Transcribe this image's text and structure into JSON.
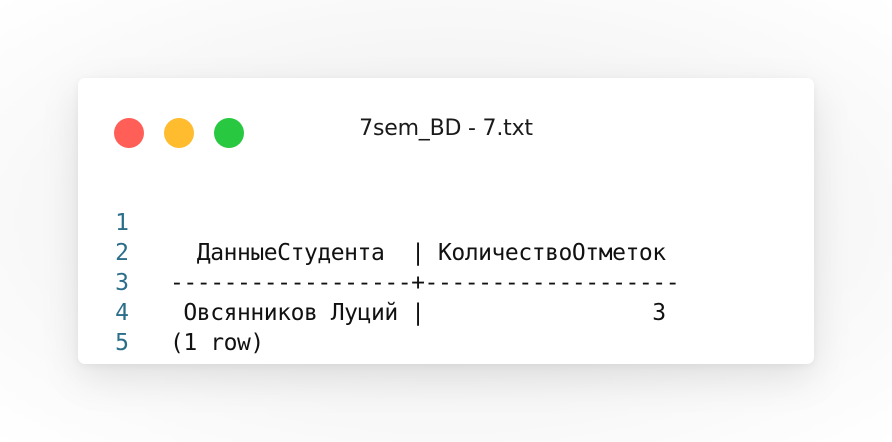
{
  "window": {
    "title": "7sem_BD - 7.txt",
    "controls": {
      "close_color": "#ff5f57",
      "minimize_color": "#febc2e",
      "maximize_color": "#28c840"
    }
  },
  "editor": {
    "lines": [
      {
        "number": "1",
        "text": "  ДанныеСтудента  | КоличествоОтметок"
      },
      {
        "number": "2",
        "text": "------------------+-------------------"
      },
      {
        "number": "3",
        "text": " Овсянников Луций |                 3"
      },
      {
        "number": "4",
        "text": "(1 row)"
      },
      {
        "number": "5",
        "text": ""
      }
    ],
    "line_number_color": "#2b6e8a"
  }
}
